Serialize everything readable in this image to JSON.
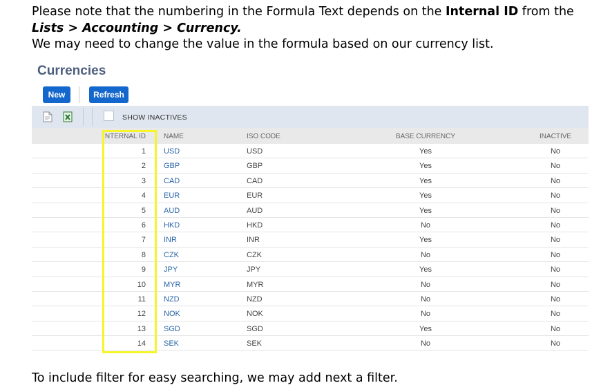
{
  "note": {
    "p1_a": "Please note that the numbering in the Formula Text depends on the ",
    "p1_b": "Internal ID",
    "p1_c": " from the ",
    "p1_d": "Lists > Accounting > Currency.",
    "p2": "We may need to change the value in the formula based on our currency list."
  },
  "footer": "To include filter for easy searching, we may add next a filter.",
  "panel": {
    "title": "Currencies",
    "new_label": "New",
    "refresh_label": "Refresh",
    "show_inactives_label": "SHOW INACTIVES",
    "show_inactives_checked": false
  },
  "table": {
    "headers": [
      "INTERNAL ID",
      "NAME",
      "ISO CODE",
      "BASE CURRENCY",
      "INACTIVE"
    ],
    "rows": [
      {
        "id": "1",
        "name": "USD",
        "iso": "USD",
        "base": "Yes",
        "inactive": "No"
      },
      {
        "id": "2",
        "name": "GBP",
        "iso": "GBP",
        "base": "Yes",
        "inactive": "No"
      },
      {
        "id": "3",
        "name": "CAD",
        "iso": "CAD",
        "base": "Yes",
        "inactive": "No"
      },
      {
        "id": "4",
        "name": "EUR",
        "iso": "EUR",
        "base": "Yes",
        "inactive": "No"
      },
      {
        "id": "5",
        "name": "AUD",
        "iso": "AUD",
        "base": "Yes",
        "inactive": "No"
      },
      {
        "id": "6",
        "name": "HKD",
        "iso": "HKD",
        "base": "No",
        "inactive": "No"
      },
      {
        "id": "7",
        "name": "INR",
        "iso": "INR",
        "base": "Yes",
        "inactive": "No"
      },
      {
        "id": "8",
        "name": "CZK",
        "iso": "CZK",
        "base": "No",
        "inactive": "No"
      },
      {
        "id": "9",
        "name": "JPY",
        "iso": "JPY",
        "base": "Yes",
        "inactive": "No"
      },
      {
        "id": "10",
        "name": "MYR",
        "iso": "MYR",
        "base": "No",
        "inactive": "No"
      },
      {
        "id": "11",
        "name": "NZD",
        "iso": "NZD",
        "base": "No",
        "inactive": "No"
      },
      {
        "id": "12",
        "name": "NOK",
        "iso": "NOK",
        "base": "No",
        "inactive": "No"
      },
      {
        "id": "13",
        "name": "SGD",
        "iso": "SGD",
        "base": "Yes",
        "inactive": "No"
      },
      {
        "id": "14",
        "name": "SEK",
        "iso": "SEK",
        "base": "No",
        "inactive": "No"
      }
    ]
  },
  "colors": {
    "button_blue": "#1467cc",
    "title_slate": "#4d5f7c",
    "link_blue": "#2a65a8",
    "toolbar_bg": "#e0e6ef",
    "highlight_yellow": "#f5f527"
  },
  "icons": {
    "toolbar_first": "document-icon",
    "toolbar_second": "excel-export-icon"
  }
}
